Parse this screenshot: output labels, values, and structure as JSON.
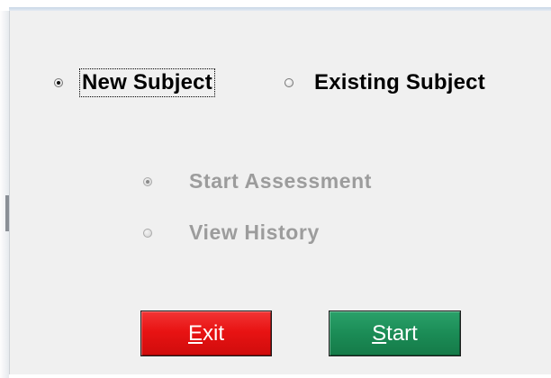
{
  "subject_mode": {
    "new_subject_label": "New Subject",
    "existing_subject_label": "Existing Subject",
    "selected": "new_subject"
  },
  "actions": {
    "start_assessment_label": "Start Assessment",
    "view_history_label": "View History",
    "selected": "start_assessment",
    "enabled": false
  },
  "buttons": {
    "exit_label_mnemonic": "E",
    "exit_label_rest": "xit",
    "start_label_mnemonic": "S",
    "start_label_rest": "tart"
  },
  "colors": {
    "exit_button": "#e81313",
    "start_button": "#1b8c56",
    "disabled_text": "#9c9c9c",
    "panel_background": "#f0f0f0"
  }
}
